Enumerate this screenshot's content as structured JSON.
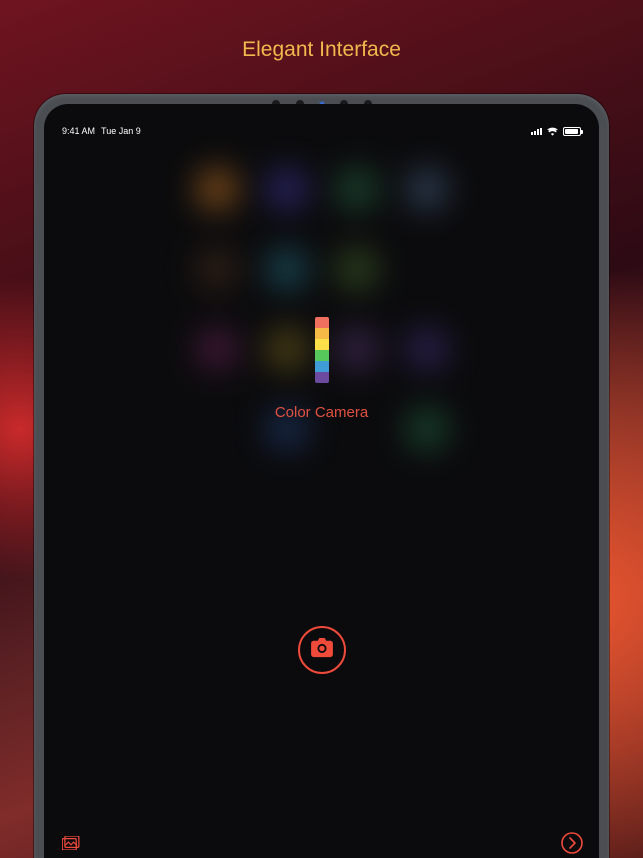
{
  "header": {
    "title": "Elegant Interface"
  },
  "status": {
    "time": "9:41 AM",
    "date": "Tue Jan 9"
  },
  "app": {
    "name": "Color Camera",
    "icon_colors": [
      "#f0705f",
      "#f5b945",
      "#fde049",
      "#56c85b",
      "#3f9cd6",
      "#6b4aa0"
    ]
  },
  "accent": "#ef4a3a",
  "blur_apps": [
    "#a8641f",
    "#342f86",
    "#245a3c",
    "#3c526d",
    "#3f2a1a",
    "#1f5e6e",
    "#3c5a26",
    "",
    "#5a1f4a",
    "#6b5a1a",
    "#4a2f62",
    "#3a2a6b",
    "",
    "#1f3a6b",
    "",
    "#1f5a3c"
  ]
}
